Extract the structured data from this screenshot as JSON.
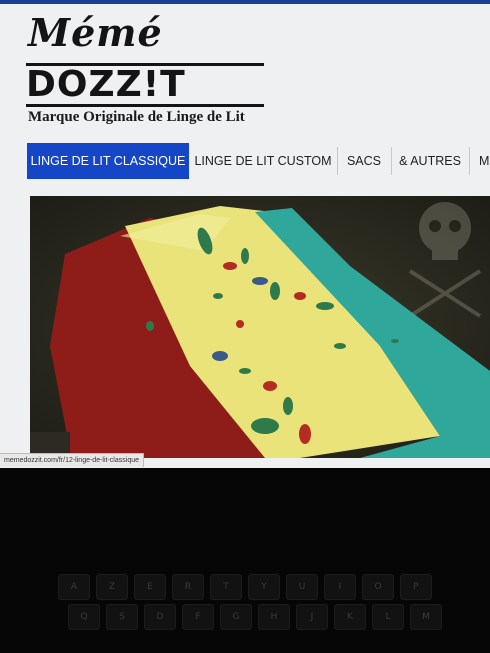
{
  "brand": {
    "script_name": "Mémé",
    "wordmark": "DOZZ!T",
    "tagline": "Marque Originale de Linge de Lit"
  },
  "nav": {
    "items": [
      {
        "label": "LINGE DE LIT CLASSIQUE",
        "active": true
      },
      {
        "label": "LINGE DE LIT CUSTOM",
        "active": false
      },
      {
        "label": "SACS",
        "active": false
      },
      {
        "label": "& AUTRES",
        "active": false
      },
      {
        "label": "M",
        "active": false
      }
    ]
  },
  "status_bar": {
    "url": "memedozzit.com/fr/12-linge-de-lit-classique"
  },
  "keyboard": {
    "row1": [
      "A",
      "Z",
      "E",
      "R",
      "T",
      "Y",
      "U",
      "I",
      "O",
      "P"
    ],
    "row2": [
      "Q",
      "S",
      "D",
      "F",
      "G",
      "H",
      "J",
      "K",
      "L",
      "M"
    ]
  },
  "colors": {
    "nav_active": "#1646c8",
    "duvet_red": "#8e1d1a",
    "duvet_yellow": "#e9e37a",
    "duvet_teal": "#2fa79a",
    "background": "#eef0f2"
  }
}
